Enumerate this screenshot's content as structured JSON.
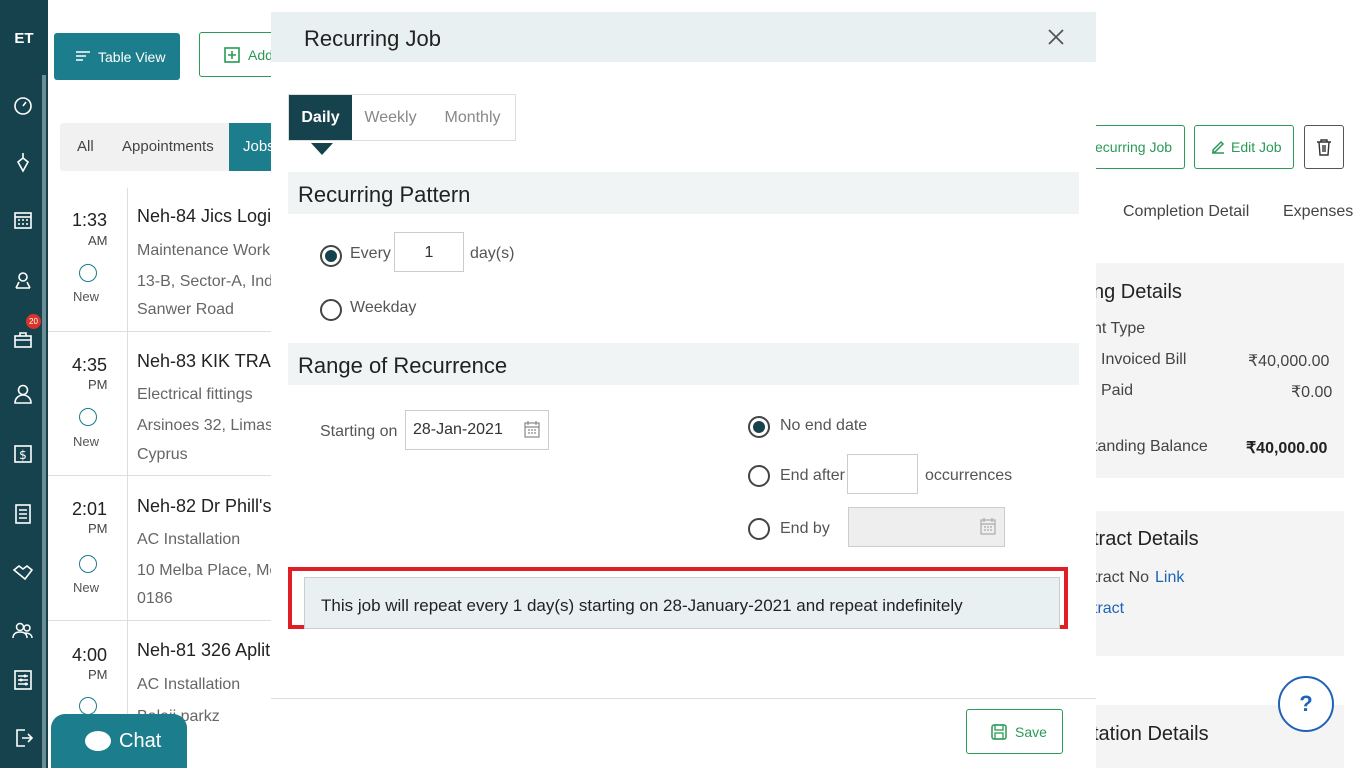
{
  "sidebar": {
    "logo": "ET",
    "badge": "20",
    "icons": [
      "dashboard-icon",
      "pen-tool-icon",
      "calendar-icon",
      "map-pin-icon",
      "briefcase-icon",
      "user-icon",
      "dollar-icon",
      "list-icon",
      "handshake-icon",
      "users-icon",
      "settings-sliders-icon",
      "logout-icon"
    ]
  },
  "toolbar": {
    "table_view_label": "Table View",
    "add_label": "Add"
  },
  "tabs": {
    "all": "All",
    "appointments": "Appointments",
    "jobs": "Jobs"
  },
  "jobs": [
    {
      "time": "1:33",
      "ampm": "AM",
      "status": "New",
      "title": "Neh-84 Jics Logi",
      "type": "Maintenance Work",
      "addr1": "13-B, Sector-A, Ind",
      "addr2": "Sanwer Road"
    },
    {
      "time": "4:35",
      "ampm": "PM",
      "status": "New",
      "title": "Neh-83 KIK TRA",
      "type": "Electrical fittings",
      "addr1": "Arsinoes 32, Limass",
      "addr2": "Cyprus"
    },
    {
      "time": "2:01",
      "ampm": "PM",
      "status": "New",
      "title": "Neh-82 Dr Phill's",
      "type": "AC Installation",
      "addr1": "10 Melba Place, Mo",
      "addr2": "0186"
    },
    {
      "time": "4:00",
      "ampm": "PM",
      "status": "",
      "title": "Neh-81 326 Aplit",
      "type": "AC Installation",
      "addr1": "Balaji parkz",
      "addr2": ""
    }
  ],
  "chat_label": "Chat",
  "right": {
    "recurring_btn": "ecurring Job",
    "edit_btn": "Edit Job",
    "tab_completion": "Completion Detail",
    "tab_expenses": "Expenses",
    "billing_head": "ng Details",
    "billing_type": "nt Type",
    "invoiced_label": "l Invoiced Bill",
    "invoiced_val": "₹40,000.00",
    "paid_label": "l Paid",
    "paid_val": "₹0.00",
    "outstanding_label": "tanding Balance",
    "outstanding_val": "₹40,000.00",
    "contract_head": "tract Details",
    "contract_no_label": "tract No",
    "contract_link": "Link",
    "contract_line2": "tract",
    "quotation_head": "tation Details",
    "help": "?"
  },
  "modal": {
    "title": "Recurring Job",
    "tabs": [
      "Daily",
      "Weekly",
      "Monthly"
    ],
    "recurring_pattern": "Recurring Pattern",
    "every_label": "Every",
    "every_value": "1",
    "days_label": "day(s)",
    "weekday_label": "Weekday",
    "range_head": "Range of Recurrence",
    "starting_on_label": "Starting on",
    "starting_on_value": "28-Jan-2021",
    "no_end_label": "No end date",
    "end_after_label": "End after",
    "occurrences_label": "occurrences",
    "end_by_label": "End by",
    "summary": "This job will repeat every 1 day(s) starting on 28-January-2021 and repeat indefinitely",
    "save_label": "Save"
  }
}
